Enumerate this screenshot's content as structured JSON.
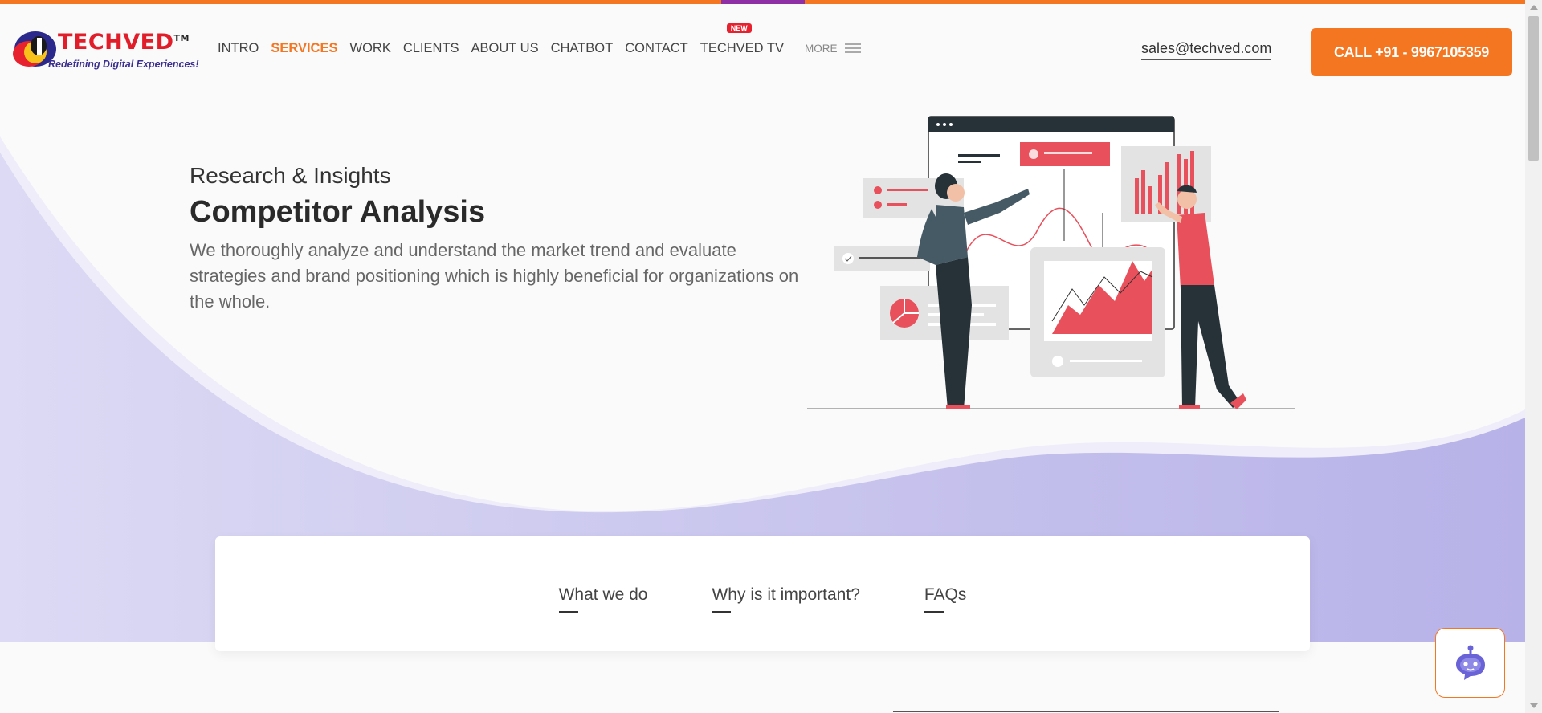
{
  "brand": {
    "name": "TECHVED",
    "trademark": "TM",
    "tagline": "Redefining Digital Experiences!"
  },
  "nav": {
    "items": [
      {
        "label": "INTRO",
        "active": false
      },
      {
        "label": "SERVICES",
        "active": true
      },
      {
        "label": "WORK",
        "active": false
      },
      {
        "label": "CLIENTS",
        "active": false
      },
      {
        "label": "ABOUT US",
        "active": false
      },
      {
        "label": "CHATBOT",
        "active": false
      },
      {
        "label": "CONTACT",
        "active": false
      },
      {
        "label": "TECHVED TV",
        "active": false,
        "badge": "NEW"
      }
    ],
    "more_label": "MORE"
  },
  "contact": {
    "email": "sales@techved.com",
    "call_label": "CALL +91 - 9967105359"
  },
  "hero": {
    "kicker": "Research & Insights",
    "title": "Competitor Analysis",
    "description": "We thoroughly analyze and understand the market trend and evaluate strategies and brand positioning which is highly beneficial for organizations on the whole."
  },
  "tabs": [
    "What we do",
    "Why is it important?",
    "FAQs"
  ],
  "colors": {
    "accent": "#f47621",
    "purple": "#8e2fa5",
    "red": "#e8505b",
    "wave": "#c9c6ee"
  },
  "icons": {
    "chat": "chatbot-icon",
    "menu": "hamburger-icon"
  }
}
